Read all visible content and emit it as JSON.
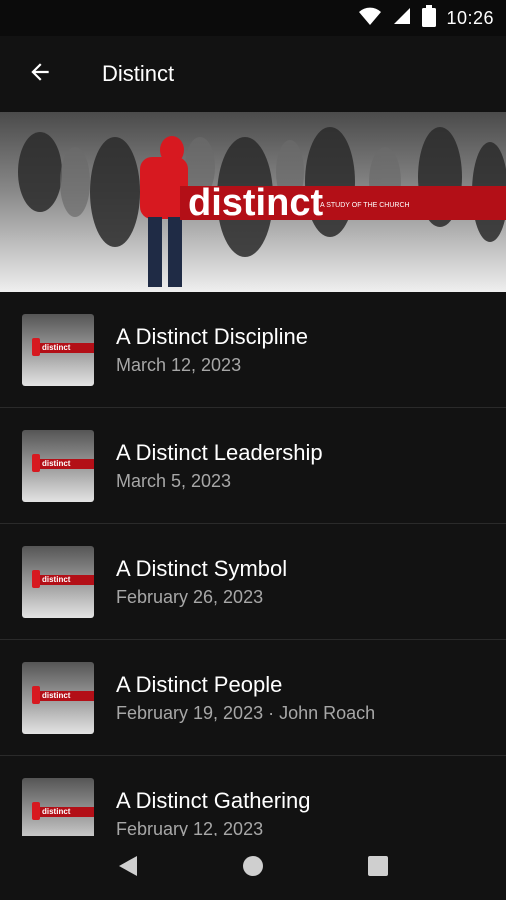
{
  "status": {
    "time": "10:26"
  },
  "app_bar": {
    "title": "Distinct"
  },
  "banner": {
    "word": "distinct",
    "tagline": "A STUDY OF THE CHURCH"
  },
  "items": [
    {
      "title": "A Distinct Discipline",
      "date": "March 12, 2023",
      "thumb_word": "distinct"
    },
    {
      "title": "A Distinct Leadership",
      "date": "March 5, 2023",
      "thumb_word": "distinct"
    },
    {
      "title": "A Distinct Symbol",
      "date": "February 26, 2023",
      "thumb_word": "distinct"
    },
    {
      "title": "A Distinct People",
      "date": "February 19, 2023 · John Roach",
      "thumb_word": "distinct"
    },
    {
      "title": "A Distinct Gathering",
      "date": "February 12, 2023",
      "thumb_word": "distinct"
    }
  ],
  "icons": {
    "back": "arrow-left-icon",
    "wifi": "wifi-icon",
    "signal": "signal-icon",
    "battery": "battery-icon",
    "nav_back": "nav-back-icon",
    "nav_home": "nav-home-icon",
    "nav_recent": "nav-recent-icon"
  },
  "colors": {
    "background": "#121212",
    "accent_red": "#b30f17",
    "subtext": "#a7a7a7"
  }
}
